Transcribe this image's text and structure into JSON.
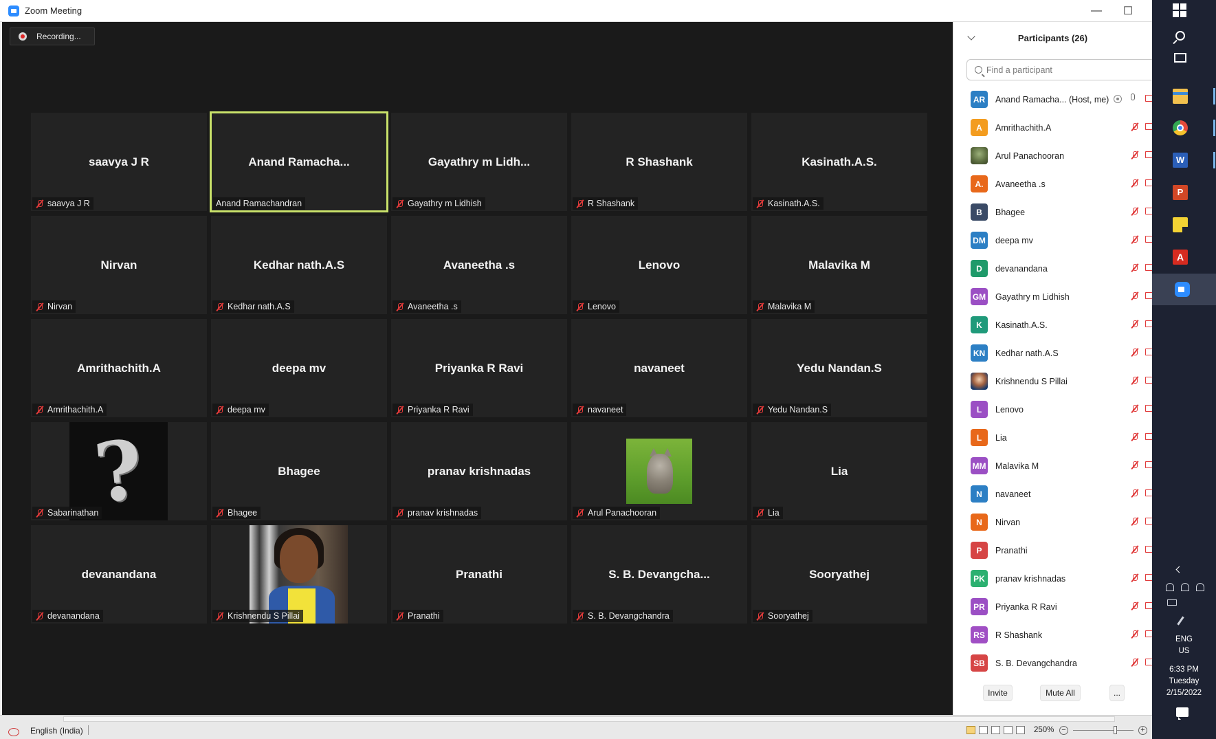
{
  "window": {
    "title": "Zoom Meeting",
    "minimize": "—",
    "maximize": "☐"
  },
  "recording": {
    "label": "Recording..."
  },
  "tiles": [
    {
      "big": "saavya J R",
      "label": "saavya J R",
      "type": "name"
    },
    {
      "big": "Anand  Ramacha...",
      "label": "Anand Ramachandran",
      "type": "name",
      "active": true
    },
    {
      "big": "Gayathry  m  Lidh...",
      "label": "Gayathry m Lidhish",
      "type": "name"
    },
    {
      "big": "R Shashank",
      "label": "R Shashank",
      "type": "name"
    },
    {
      "big": "Kasinath.A.S.",
      "label": "Kasinath.A.S.",
      "type": "name"
    },
    {
      "big": "Nirvan",
      "label": "Nirvan",
      "type": "name"
    },
    {
      "big": "Kedhar nath.A.S",
      "label": "Kedhar nath.A.S",
      "type": "name"
    },
    {
      "big": "Avaneetha .s",
      "label": "Avaneetha .s",
      "type": "name"
    },
    {
      "big": "Lenovo",
      "label": "Lenovo",
      "type": "name"
    },
    {
      "big": "Malavika M",
      "label": "Malavika M",
      "type": "name"
    },
    {
      "big": "Amrithachith.A",
      "label": "Amrithachith.A",
      "type": "name"
    },
    {
      "big": "deepa mv",
      "label": "deepa mv",
      "type": "name"
    },
    {
      "big": "Priyanka R Ravi",
      "label": "Priyanka R Ravi",
      "type": "name"
    },
    {
      "big": "navaneet",
      "label": "navaneet",
      "type": "name"
    },
    {
      "big": "Yedu Nandan.S",
      "label": "Yedu Nandan.S",
      "type": "name"
    },
    {
      "big": "",
      "label": "Sabarinathan",
      "type": "question"
    },
    {
      "big": "Bhagee",
      "label": "Bhagee",
      "type": "name"
    },
    {
      "big": "pranav krishnadas",
      "label": "pranav krishnadas",
      "type": "name"
    },
    {
      "big": "",
      "label": "Arul Panachooran",
      "type": "cat"
    },
    {
      "big": "Lia",
      "label": "Lia",
      "type": "name"
    },
    {
      "big": "devanandana",
      "label": "devanandana",
      "type": "name"
    },
    {
      "big": "",
      "label": "Krishnendu S Pillai",
      "type": "girl"
    },
    {
      "big": "Pranathi",
      "label": "Pranathi",
      "type": "name"
    },
    {
      "big": "S. B. Devangcha...",
      "label": "S. B. Devangchandra",
      "type": "name"
    },
    {
      "big": "Sooryathej",
      "label": "Sooryathej",
      "type": "name"
    }
  ],
  "participants": {
    "title": "Participants (26)",
    "search_placeholder": "Find a participant",
    "list": [
      {
        "initials": "AR",
        "name": "Anand Ramacha... (Host, me)",
        "color": "#2c7fc4",
        "host": true
      },
      {
        "initials": "A",
        "name": "Amrithachith.A",
        "color": "#f39c1f"
      },
      {
        "initials": "",
        "name": "Arul Panachooran",
        "color": "",
        "photo": "photo1"
      },
      {
        "initials": "A.",
        "name": "Avaneetha .s",
        "color": "#e8681a"
      },
      {
        "initials": "B",
        "name": "Bhagee",
        "color": "#3a4a66"
      },
      {
        "initials": "DM",
        "name": "deepa mv",
        "color": "#2c7fc4"
      },
      {
        "initials": "D",
        "name": "devanandana",
        "color": "#1f9a6a"
      },
      {
        "initials": "GM",
        "name": "Gayathry m Lidhish",
        "color": "#9b4fc4"
      },
      {
        "initials": "K",
        "name": "Kasinath.A.S.",
        "color": "#1f9a7a"
      },
      {
        "initials": "KN",
        "name": "Kedhar nath.A.S",
        "color": "#2c7fc4"
      },
      {
        "initials": "",
        "name": "Krishnendu S Pillai",
        "color": "",
        "photo": "photo2"
      },
      {
        "initials": "L",
        "name": "Lenovo",
        "color": "#9b4fc4"
      },
      {
        "initials": "L",
        "name": "Lia",
        "color": "#e8681a"
      },
      {
        "initials": "MM",
        "name": "Malavika M",
        "color": "#9b4fc4"
      },
      {
        "initials": "N",
        "name": "navaneet",
        "color": "#2c7fc4"
      },
      {
        "initials": "N",
        "name": "Nirvan",
        "color": "#e8681a"
      },
      {
        "initials": "P",
        "name": "Pranathi",
        "color": "#d64545"
      },
      {
        "initials": "PK",
        "name": "pranav krishnadas",
        "color": "#2cb070"
      },
      {
        "initials": "PR",
        "name": "Priyanka R Ravi",
        "color": "#9b4fc4"
      },
      {
        "initials": "RS",
        "name": "R Shashank",
        "color": "#a04fc4"
      },
      {
        "initials": "SB",
        "name": "S. B. Devangchandra",
        "color": "#d64545"
      }
    ],
    "invite_label": "Invite",
    "mute_all_label": "Mute All",
    "more_label": "..."
  },
  "statusbar": {
    "language": "English (India)",
    "zoom": "250%"
  },
  "taskbar": {
    "lang_line1": "ENG",
    "lang_line2": "US",
    "time": "6:33 PM",
    "day": "Tuesday",
    "date": "2/15/2022"
  }
}
